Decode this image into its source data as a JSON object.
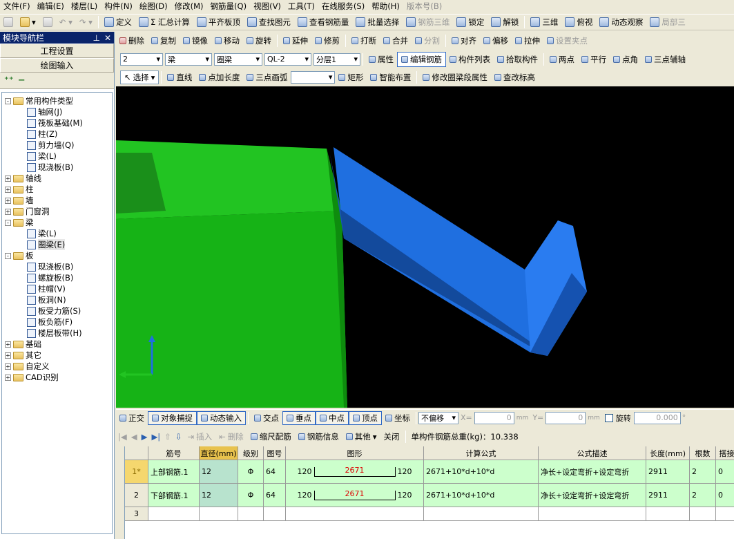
{
  "menu": [
    "文件(F)",
    "编辑(E)",
    "楼层(L)",
    "构件(N)",
    "绘图(D)",
    "修改(M)",
    "钢筋量(Q)",
    "视图(V)",
    "工具(T)",
    "在线服务(S)",
    "帮助(H)",
    "版本号(B)"
  ],
  "toolbar1": [
    {
      "label": "定义",
      "enabled": true
    },
    {
      "label": "Σ 汇总计算",
      "enabled": true
    },
    {
      "label": "平齐板顶",
      "enabled": true
    },
    {
      "label": "查找图元",
      "enabled": true
    },
    {
      "label": "查看钢筋量",
      "enabled": true
    },
    {
      "label": "批量选择",
      "enabled": true
    },
    {
      "label": "钢筋三维",
      "enabled": false
    },
    {
      "label": "锁定",
      "enabled": true
    },
    {
      "label": "解锁",
      "enabled": true
    },
    {
      "label": "三维",
      "enabled": true
    },
    {
      "label": "俯视",
      "enabled": true
    },
    {
      "label": "动态观察",
      "enabled": true
    },
    {
      "label": "局部三",
      "enabled": false
    }
  ],
  "toolbar2": [
    {
      "label": "删除",
      "enabled": true
    },
    {
      "label": "复制",
      "enabled": true
    },
    {
      "label": "镜像",
      "enabled": true
    },
    {
      "label": "移动",
      "enabled": true
    },
    {
      "label": "旋转",
      "enabled": true
    },
    {
      "label": "延伸",
      "enabled": true
    },
    {
      "label": "修剪",
      "enabled": true
    },
    {
      "label": "打断",
      "enabled": true
    },
    {
      "label": "合并",
      "enabled": true
    },
    {
      "label": "分割",
      "enabled": false
    },
    {
      "label": "对齐",
      "enabled": true
    },
    {
      "label": "偏移",
      "enabled": true
    },
    {
      "label": "拉伸",
      "enabled": true
    },
    {
      "label": "设置夹点",
      "enabled": false
    }
  ],
  "toolbar3": {
    "floor": "2",
    "category": "梁",
    "subtype": "圈梁",
    "component": "QL-2",
    "layer": "分层1",
    "buttons": [
      "属性",
      "编辑钢筋",
      "构件列表",
      "拾取构件",
      "两点",
      "平行",
      "点角",
      "三点辅轴"
    ]
  },
  "toolbar4": {
    "select": "选择",
    "buttons": [
      "直线",
      "点加长度",
      "三点画弧",
      "矩形",
      "智能布置",
      "修改圈梁段属性",
      "查改标高"
    ]
  },
  "sidebar": {
    "title": "模块导航栏",
    "btn_settings": "工程设置",
    "btn_drawing": "绘图输入",
    "tree": [
      {
        "label": "常用构件类型",
        "level": 0,
        "exp": "-",
        "type": "folder"
      },
      {
        "label": "轴网(J)",
        "level": 1,
        "type": "leaf"
      },
      {
        "label": "筏板基础(M)",
        "level": 1,
        "type": "leaf"
      },
      {
        "label": "柱(Z)",
        "level": 1,
        "type": "leaf"
      },
      {
        "label": "剪力墙(Q)",
        "level": 1,
        "type": "leaf"
      },
      {
        "label": "梁(L)",
        "level": 1,
        "type": "leaf"
      },
      {
        "label": "现浇板(B)",
        "level": 1,
        "type": "leaf"
      },
      {
        "label": "轴线",
        "level": 0,
        "exp": "+",
        "type": "folder"
      },
      {
        "label": "柱",
        "level": 0,
        "exp": "+",
        "type": "folder"
      },
      {
        "label": "墙",
        "level": 0,
        "exp": "+",
        "type": "folder"
      },
      {
        "label": "门窗洞",
        "level": 0,
        "exp": "+",
        "type": "folder"
      },
      {
        "label": "梁",
        "level": 0,
        "exp": "-",
        "type": "folder"
      },
      {
        "label": "梁(L)",
        "level": 1,
        "type": "leaf"
      },
      {
        "label": "圈梁(E)",
        "level": 1,
        "type": "leaf",
        "selected": true
      },
      {
        "label": "板",
        "level": 0,
        "exp": "-",
        "type": "folder"
      },
      {
        "label": "现浇板(B)",
        "level": 1,
        "type": "leaf"
      },
      {
        "label": "螺旋板(B)",
        "level": 1,
        "type": "leaf"
      },
      {
        "label": "柱帽(V)",
        "level": 1,
        "type": "leaf"
      },
      {
        "label": "板洞(N)",
        "level": 1,
        "type": "leaf"
      },
      {
        "label": "板受力筋(S)",
        "level": 1,
        "type": "leaf"
      },
      {
        "label": "板负筋(F)",
        "level": 1,
        "type": "leaf"
      },
      {
        "label": "楼层板带(H)",
        "level": 1,
        "type": "leaf"
      },
      {
        "label": "基础",
        "level": 0,
        "exp": "+",
        "type": "folder"
      },
      {
        "label": "其它",
        "level": 0,
        "exp": "+",
        "type": "folder"
      },
      {
        "label": "自定义",
        "level": 0,
        "exp": "+",
        "type": "folder"
      },
      {
        "label": "CAD识别",
        "level": 0,
        "exp": "+",
        "type": "folder"
      }
    ]
  },
  "snapbar": {
    "buttons": [
      "正交",
      "对象捕捉",
      "动态输入",
      "交点",
      "垂点",
      "中点",
      "顶点",
      "坐标"
    ],
    "offset_mode": "不偏移",
    "x_label": "X=",
    "x_value": "0",
    "y_label": "Y=",
    "y_value": "0",
    "unit": "mm",
    "rotate_label": "旋转",
    "rotate_value": "0.000",
    "degree": "°"
  },
  "gridbar": {
    "insert": "插入",
    "delete": "删除",
    "scale": "缩尺配筋",
    "info": "钢筋信息",
    "other": "其他",
    "close": "关闭",
    "total_weight": "单构件钢筋总重(kg)：10.338"
  },
  "table": {
    "headers": [
      "筋号",
      "直径(mm)",
      "级别",
      "图号",
      "图形",
      "计算公式",
      "公式描述",
      "长度(mm)",
      "根数",
      "搭接"
    ],
    "rows": [
      {
        "num": "1*",
        "name": "上部钢筋.1",
        "dia": "12",
        "grade": "Φ",
        "fig": "64",
        "left": "120",
        "mid": "2671",
        "right": "120",
        "formula": "2671+10*d+10*d",
        "desc": "净长+设定弯折+设定弯折",
        "length": "2911",
        "count": "2",
        "lap": "0"
      },
      {
        "num": "2",
        "name": "下部钢筋.1",
        "dia": "12",
        "grade": "Φ",
        "fig": "64",
        "left": "120",
        "mid": "2671",
        "right": "120",
        "formula": "2671+10*d+10*d",
        "desc": "净长+设定弯折+设定弯折",
        "length": "2911",
        "count": "2",
        "lap": "0"
      },
      {
        "num": "3",
        "name": "",
        "dia": "",
        "grade": "",
        "fig": "",
        "left": "",
        "mid": "",
        "right": "",
        "formula": "",
        "desc": "",
        "length": "",
        "count": "",
        "lap": ""
      }
    ]
  },
  "colors": {
    "slab": "#1acc1a",
    "beam": "#1f6fe0",
    "viewport_bg": "#000000",
    "grid_row": "#ccffcc"
  }
}
